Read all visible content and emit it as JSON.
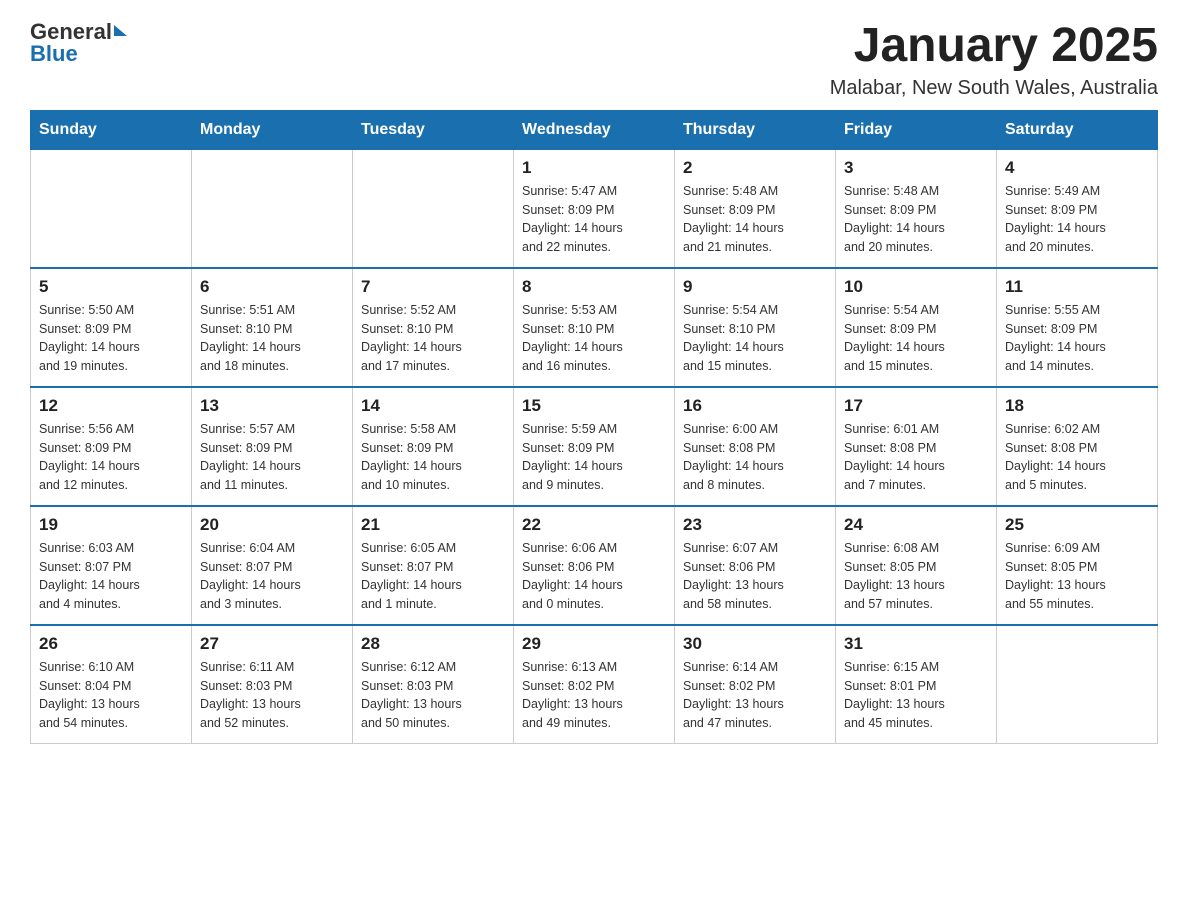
{
  "header": {
    "logo_general": "General",
    "logo_blue": "Blue",
    "title": "January 2025",
    "subtitle": "Malabar, New South Wales, Australia"
  },
  "weekdays": [
    "Sunday",
    "Monday",
    "Tuesday",
    "Wednesday",
    "Thursday",
    "Friday",
    "Saturday"
  ],
  "weeks": [
    [
      {
        "day": "",
        "info": ""
      },
      {
        "day": "",
        "info": ""
      },
      {
        "day": "",
        "info": ""
      },
      {
        "day": "1",
        "info": "Sunrise: 5:47 AM\nSunset: 8:09 PM\nDaylight: 14 hours\nand 22 minutes."
      },
      {
        "day": "2",
        "info": "Sunrise: 5:48 AM\nSunset: 8:09 PM\nDaylight: 14 hours\nand 21 minutes."
      },
      {
        "day": "3",
        "info": "Sunrise: 5:48 AM\nSunset: 8:09 PM\nDaylight: 14 hours\nand 20 minutes."
      },
      {
        "day": "4",
        "info": "Sunrise: 5:49 AM\nSunset: 8:09 PM\nDaylight: 14 hours\nand 20 minutes."
      }
    ],
    [
      {
        "day": "5",
        "info": "Sunrise: 5:50 AM\nSunset: 8:09 PM\nDaylight: 14 hours\nand 19 minutes."
      },
      {
        "day": "6",
        "info": "Sunrise: 5:51 AM\nSunset: 8:10 PM\nDaylight: 14 hours\nand 18 minutes."
      },
      {
        "day": "7",
        "info": "Sunrise: 5:52 AM\nSunset: 8:10 PM\nDaylight: 14 hours\nand 17 minutes."
      },
      {
        "day": "8",
        "info": "Sunrise: 5:53 AM\nSunset: 8:10 PM\nDaylight: 14 hours\nand 16 minutes."
      },
      {
        "day": "9",
        "info": "Sunrise: 5:54 AM\nSunset: 8:10 PM\nDaylight: 14 hours\nand 15 minutes."
      },
      {
        "day": "10",
        "info": "Sunrise: 5:54 AM\nSunset: 8:09 PM\nDaylight: 14 hours\nand 15 minutes."
      },
      {
        "day": "11",
        "info": "Sunrise: 5:55 AM\nSunset: 8:09 PM\nDaylight: 14 hours\nand 14 minutes."
      }
    ],
    [
      {
        "day": "12",
        "info": "Sunrise: 5:56 AM\nSunset: 8:09 PM\nDaylight: 14 hours\nand 12 minutes."
      },
      {
        "day": "13",
        "info": "Sunrise: 5:57 AM\nSunset: 8:09 PM\nDaylight: 14 hours\nand 11 minutes."
      },
      {
        "day": "14",
        "info": "Sunrise: 5:58 AM\nSunset: 8:09 PM\nDaylight: 14 hours\nand 10 minutes."
      },
      {
        "day": "15",
        "info": "Sunrise: 5:59 AM\nSunset: 8:09 PM\nDaylight: 14 hours\nand 9 minutes."
      },
      {
        "day": "16",
        "info": "Sunrise: 6:00 AM\nSunset: 8:08 PM\nDaylight: 14 hours\nand 8 minutes."
      },
      {
        "day": "17",
        "info": "Sunrise: 6:01 AM\nSunset: 8:08 PM\nDaylight: 14 hours\nand 7 minutes."
      },
      {
        "day": "18",
        "info": "Sunrise: 6:02 AM\nSunset: 8:08 PM\nDaylight: 14 hours\nand 5 minutes."
      }
    ],
    [
      {
        "day": "19",
        "info": "Sunrise: 6:03 AM\nSunset: 8:07 PM\nDaylight: 14 hours\nand 4 minutes."
      },
      {
        "day": "20",
        "info": "Sunrise: 6:04 AM\nSunset: 8:07 PM\nDaylight: 14 hours\nand 3 minutes."
      },
      {
        "day": "21",
        "info": "Sunrise: 6:05 AM\nSunset: 8:07 PM\nDaylight: 14 hours\nand 1 minute."
      },
      {
        "day": "22",
        "info": "Sunrise: 6:06 AM\nSunset: 8:06 PM\nDaylight: 14 hours\nand 0 minutes."
      },
      {
        "day": "23",
        "info": "Sunrise: 6:07 AM\nSunset: 8:06 PM\nDaylight: 13 hours\nand 58 minutes."
      },
      {
        "day": "24",
        "info": "Sunrise: 6:08 AM\nSunset: 8:05 PM\nDaylight: 13 hours\nand 57 minutes."
      },
      {
        "day": "25",
        "info": "Sunrise: 6:09 AM\nSunset: 8:05 PM\nDaylight: 13 hours\nand 55 minutes."
      }
    ],
    [
      {
        "day": "26",
        "info": "Sunrise: 6:10 AM\nSunset: 8:04 PM\nDaylight: 13 hours\nand 54 minutes."
      },
      {
        "day": "27",
        "info": "Sunrise: 6:11 AM\nSunset: 8:03 PM\nDaylight: 13 hours\nand 52 minutes."
      },
      {
        "day": "28",
        "info": "Sunrise: 6:12 AM\nSunset: 8:03 PM\nDaylight: 13 hours\nand 50 minutes."
      },
      {
        "day": "29",
        "info": "Sunrise: 6:13 AM\nSunset: 8:02 PM\nDaylight: 13 hours\nand 49 minutes."
      },
      {
        "day": "30",
        "info": "Sunrise: 6:14 AM\nSunset: 8:02 PM\nDaylight: 13 hours\nand 47 minutes."
      },
      {
        "day": "31",
        "info": "Sunrise: 6:15 AM\nSunset: 8:01 PM\nDaylight: 13 hours\nand 45 minutes."
      },
      {
        "day": "",
        "info": ""
      }
    ]
  ]
}
